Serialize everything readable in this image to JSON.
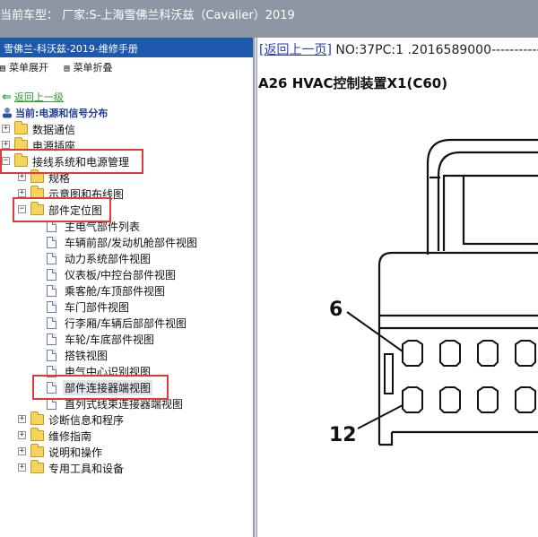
{
  "titlebar": {
    "text": "当前车型：  厂家:S-上海雪佛兰科沃兹（Cavalier）2019"
  },
  "left": {
    "header": "雪佛兰-科沃兹-2019-维修手册",
    "tools": [
      {
        "icon": "expand-all-icon",
        "label": "菜单展开"
      },
      {
        "icon": "collapse-all-icon",
        "label": "菜单折叠"
      }
    ],
    "back_label": "返回上一级",
    "current_label": "当前:电源和信号分布",
    "tree": [
      {
        "label": "数据通信",
        "pm": "+"
      },
      {
        "label": "电源插座",
        "pm": "+"
      },
      {
        "label": "接线系统和电源管理",
        "pm": "−"
      },
      {
        "label": "规格",
        "pm": "+"
      },
      {
        "label": "示意图和布线图",
        "pm": "+"
      },
      {
        "label": "部件定位图",
        "pm": "−"
      },
      {
        "label": "主电气部件列表"
      },
      {
        "label": "车辆前部/发动机舱部件视图"
      },
      {
        "label": "动力系统部件视图"
      },
      {
        "label": "仪表板/中控台部件视图"
      },
      {
        "label": "乘客舱/车顶部件视图"
      },
      {
        "label": "车门部件视图"
      },
      {
        "label": "行李厢/车辆后部部件视图"
      },
      {
        "label": "车轮/车底部件视图"
      },
      {
        "label": "搭铁视图"
      },
      {
        "label": "电气中心识别视图"
      },
      {
        "label": "部件连接器端视图"
      },
      {
        "label": "直列式线束连接器端视图"
      },
      {
        "label": "诊断信息和程序",
        "pm": "+"
      },
      {
        "label": "维修指南",
        "pm": "+"
      },
      {
        "label": "说明和操作",
        "pm": "+"
      },
      {
        "label": "专用工具和设备",
        "pm": "+"
      }
    ]
  },
  "right": {
    "back_label": "[返回上一页]",
    "doc_id": " NO:37PC:1 .2016589000-----------",
    "title": "A26 HVAC控制装置X1(C60)",
    "pin_labels": [
      "6",
      "12"
    ]
  },
  "colors": {
    "title_bar": "#8d96a3",
    "left_header": "#1d58ad",
    "highlight": "#e23a3a"
  }
}
